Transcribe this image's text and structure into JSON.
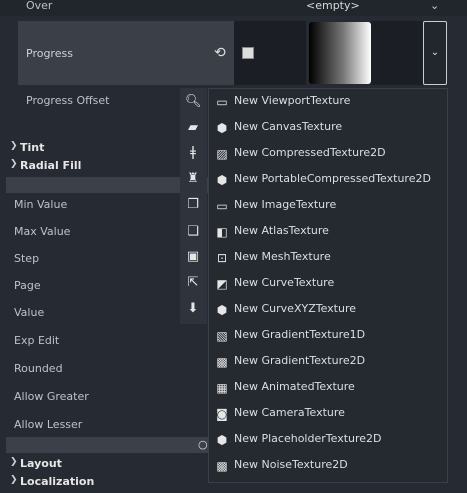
{
  "inspector": {
    "over": {
      "label": "Over",
      "value": "<empty>"
    },
    "progress": {
      "label": "Progress"
    },
    "progress_offset": {
      "label": "Progress Offset"
    },
    "sections": {
      "tint": "Tint",
      "radial_fill": "Radial Fill",
      "layout": "Layout",
      "localization": "Localization"
    },
    "range_props": [
      "Min Value",
      "Max Value",
      "Step",
      "Page",
      "Value",
      "Exp Edit",
      "Rounded",
      "Allow Greater",
      "Allow Lesser"
    ]
  },
  "menu": {
    "items": [
      {
        "label": "New ViewportTexture",
        "icon": "viewport-texture-icon"
      },
      {
        "label": "New CanvasTexture",
        "icon": "canvas-texture-icon"
      },
      {
        "label": "New CompressedTexture2D",
        "icon": "compressed-texture-icon"
      },
      {
        "label": "New PortableCompressedTexture2D",
        "icon": "portable-compressed-texture-icon"
      },
      {
        "label": "New ImageTexture",
        "icon": "image-texture-icon"
      },
      {
        "label": "New AtlasTexture",
        "icon": "atlas-texture-icon"
      },
      {
        "label": "New MeshTexture",
        "icon": "mesh-texture-icon"
      },
      {
        "label": "New CurveTexture",
        "icon": "curve-texture-icon"
      },
      {
        "label": "New CurveXYZTexture",
        "icon": "curve-xyz-texture-icon"
      },
      {
        "label": "New GradientTexture1D",
        "icon": "gradient-texture-1d-icon"
      },
      {
        "label": "New GradientTexture2D",
        "icon": "gradient-texture-2d-icon"
      },
      {
        "label": "New AnimatedTexture",
        "icon": "animated-texture-icon"
      },
      {
        "label": "New CameraTexture",
        "icon": "camera-texture-icon"
      },
      {
        "label": "New PlaceholderTexture2D",
        "icon": "placeholder-texture-icon"
      },
      {
        "label": "New NoiseTexture2D",
        "icon": "noise-texture-icon"
      }
    ]
  },
  "toolstrip": [
    "search-icon",
    "folder-open-icon",
    "pipette-icon",
    "brush-clear-icon",
    "copy-icon",
    "paste-icon",
    "save-icon",
    "make-unique-icon",
    "show-in-filesystem-icon"
  ]
}
